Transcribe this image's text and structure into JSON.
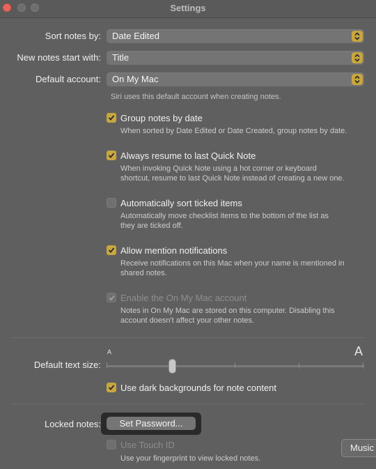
{
  "window": {
    "title": "Settings"
  },
  "rows": {
    "sort": {
      "label": "Sort notes by:",
      "value": "Date Edited"
    },
    "new_notes": {
      "label": "New notes start with:",
      "value": "Title"
    },
    "account": {
      "label": "Default account:",
      "value": "On My Mac",
      "hint": "Siri uses this default account when creating notes."
    }
  },
  "options": [
    {
      "label": "Group notes by date",
      "checked": true,
      "disabled": false,
      "desc1": "When sorted by Date Edited or Date Created, group notes by date.",
      "desc2": ""
    },
    {
      "label": "Always resume to last Quick Note",
      "checked": true,
      "disabled": false,
      "desc1": "When invoking Quick Note using a hot corner or keyboard",
      "desc2": "shortcut, resume to last Quick Note instead of creating a new one."
    },
    {
      "label": "Automatically sort ticked items",
      "checked": false,
      "disabled": false,
      "desc1": "Automatically move checklist items to the bottom of the list as",
      "desc2": "they are ticked off."
    },
    {
      "label": "Allow mention notifications",
      "checked": true,
      "disabled": false,
      "desc1": "Receive notifications on this Mac when your name is mentioned in",
      "desc2": "shared notes."
    },
    {
      "label": "Enable the On My Mac account",
      "checked": true,
      "disabled": true,
      "desc1": "Notes in On My Mac are stored on this computer. Disabling this",
      "desc2": "account doesn't affect your other notes."
    }
  ],
  "text_size": {
    "label": "Default text size:",
    "small_glyph": "A",
    "large_glyph": "A",
    "level": 0.25
  },
  "dark_bg": {
    "label": "Use dark backgrounds for note content",
    "checked": true
  },
  "locked": {
    "label": "Locked notes:",
    "button": "Set Password...",
    "touch_id_label": "Use Touch ID",
    "touch_id_desc": "Use your fingerprint to view locked notes."
  },
  "tooltip": {
    "text": "Music"
  },
  "colors": {
    "accent": "#c8a640",
    "background": "#5f5f5f"
  }
}
